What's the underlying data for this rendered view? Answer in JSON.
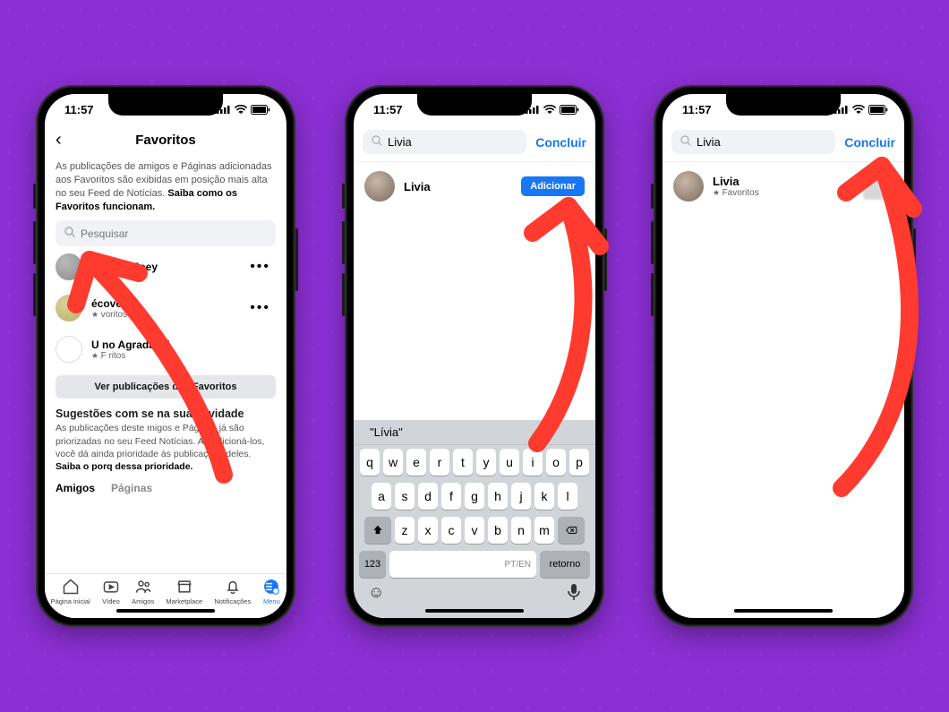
{
  "status": {
    "time": "11:57"
  },
  "phone1": {
    "nav_title": "Favoritos",
    "description": "As publicações de amigos e Páginas adicionadas aos Favoritos são exibidas em posição mais alta no seu Feed de Notícias.",
    "description_bold": "Saiba como os Favoritos funcionam.",
    "search_placeholder": "Pesquisar",
    "favorites": [
      {
        "name": "do Sem Joey",
        "sub": ""
      },
      {
        "name": "écovers",
        "sub": "voritos"
      },
      {
        "name": "U    no Agradável",
        "sub": "F   ritos"
      }
    ],
    "view_posts_label": "Ver publicações dos Favoritos",
    "suggestions_title": "Sugestões com     se na sua atividade",
    "suggestions_desc_1": "As publicações deste    migos e Páginas já são priorizadas no seu Feed    Notícias. Ao adicioná-los, você dá ainda      prioridade às publicações deles. ",
    "suggestions_desc_bold": "Saiba o porq    dessa prioridade.",
    "tabs": {
      "friends": "Amigos",
      "pages": "Páginas"
    },
    "tabbar": {
      "home": "Página inicial",
      "video": "Vídeo",
      "friends": "Amigos",
      "marketplace": "Marketplace",
      "notifications": "Notificações",
      "menu": "Menu"
    }
  },
  "phone2": {
    "search_value": "Livia",
    "done": "Concluir",
    "result_name": "Livia",
    "add_label": "Adicionar",
    "keyboard": {
      "suggestion": "\"Lívia\"",
      "row1": [
        "q",
        "w",
        "e",
        "r",
        "t",
        "y",
        "u",
        "i",
        "o",
        "p"
      ],
      "row2": [
        "a",
        "s",
        "d",
        "f",
        "g",
        "h",
        "j",
        "k",
        "l"
      ],
      "row3": [
        "z",
        "x",
        "c",
        "v",
        "b",
        "n",
        "m"
      ],
      "k123": "123",
      "space_hint": "PT/EN",
      "return": "retorno"
    }
  },
  "phone3": {
    "search_value": "Livia",
    "done": "Concluir",
    "result_name": "Livia",
    "result_sub": "Favoritos"
  },
  "colors": {
    "accent_red": "#ff3b30",
    "fb_blue": "#1877f2",
    "bg_purple": "#8b2fd3"
  }
}
